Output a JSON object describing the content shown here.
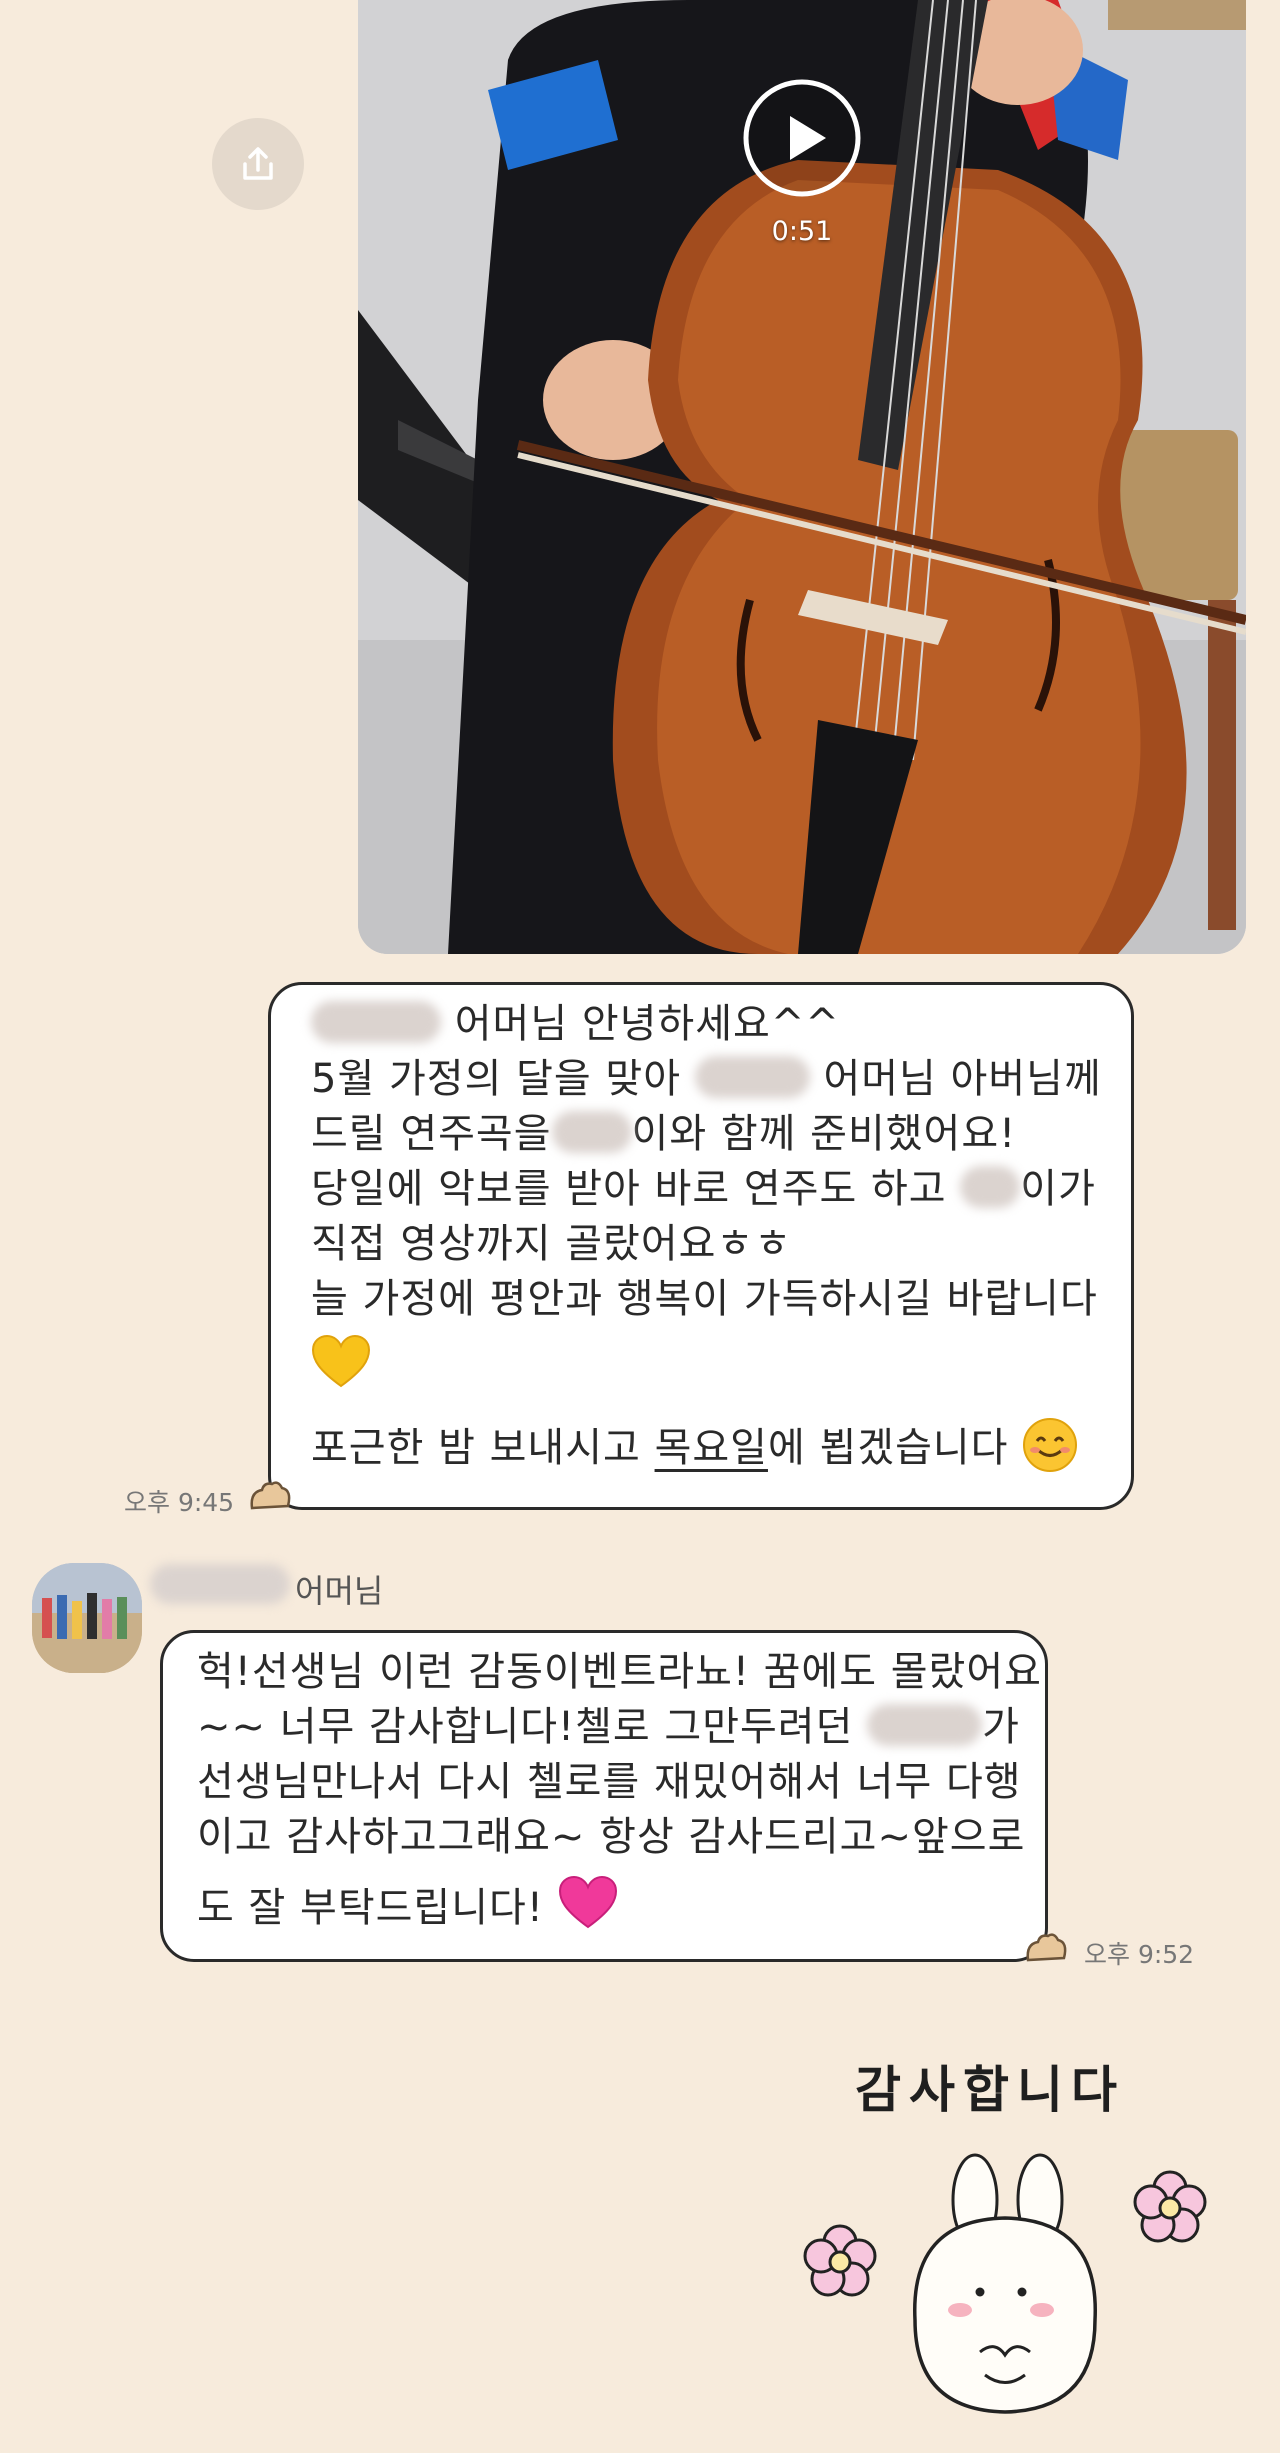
{
  "video": {
    "duration": "0:51"
  },
  "icons": {
    "share": "share-icon",
    "play": "play-icon",
    "emoji_heart_yellow": "yellow-heart-emoji",
    "emoji_smile": "smiling-face-emoji",
    "emoji_heart_pink": "pink-heart-emoji",
    "read_marker": "paw-icon"
  },
  "messages": [
    {
      "sender": "me",
      "time": "오후 9:45",
      "lines": {
        "l1": "어머님 안녕하세요^^",
        "l2a": "5월 가정의 달을 맞아",
        "l2b": "어머님 아버님께",
        "l3a": "드릴 연주곡을",
        "l3b": "이와 함께 준비했어요!",
        "l4a": "당일에 악보를 받아 바로 연주도 하고",
        "l4b": "이가",
        "l5": "직접 영상까지 골랐어요ㅎㅎ",
        "l6": "늘 가정에 평안과 행복이 가득하시길 바랍니다",
        "l8a": "포근한 밤 보내시고",
        "l8b": "목요일",
        "l8c": "에 뵙겠습니다"
      }
    },
    {
      "sender": "other",
      "sender_name": "어머님",
      "time": "오후 9:52",
      "lines": {
        "l1": "헉!선생님 이런 감동이벤트라뇨! 꿈에도 몰랐어요",
        "l2a": "~~ 너무 감사합니다!첼로 그만두려던",
        "l2b": "가",
        "l3": "선생님만나서 다시 첼로를 재밌어해서 너무 다행",
        "l4": "이고 감사하고그래요~  항상 감사드리고~앞으로",
        "l5": "도 잘 부탁드립니다!"
      }
    }
  ],
  "sticker": {
    "text": "감사합니다",
    "character": "bunny"
  },
  "colors": {
    "background": "#f7ebdc",
    "bubble": "#ffffff",
    "bubble_border": "#2a2a2a",
    "yellow_heart": "#f8c21a",
    "pink_heart": "#f0399a"
  }
}
